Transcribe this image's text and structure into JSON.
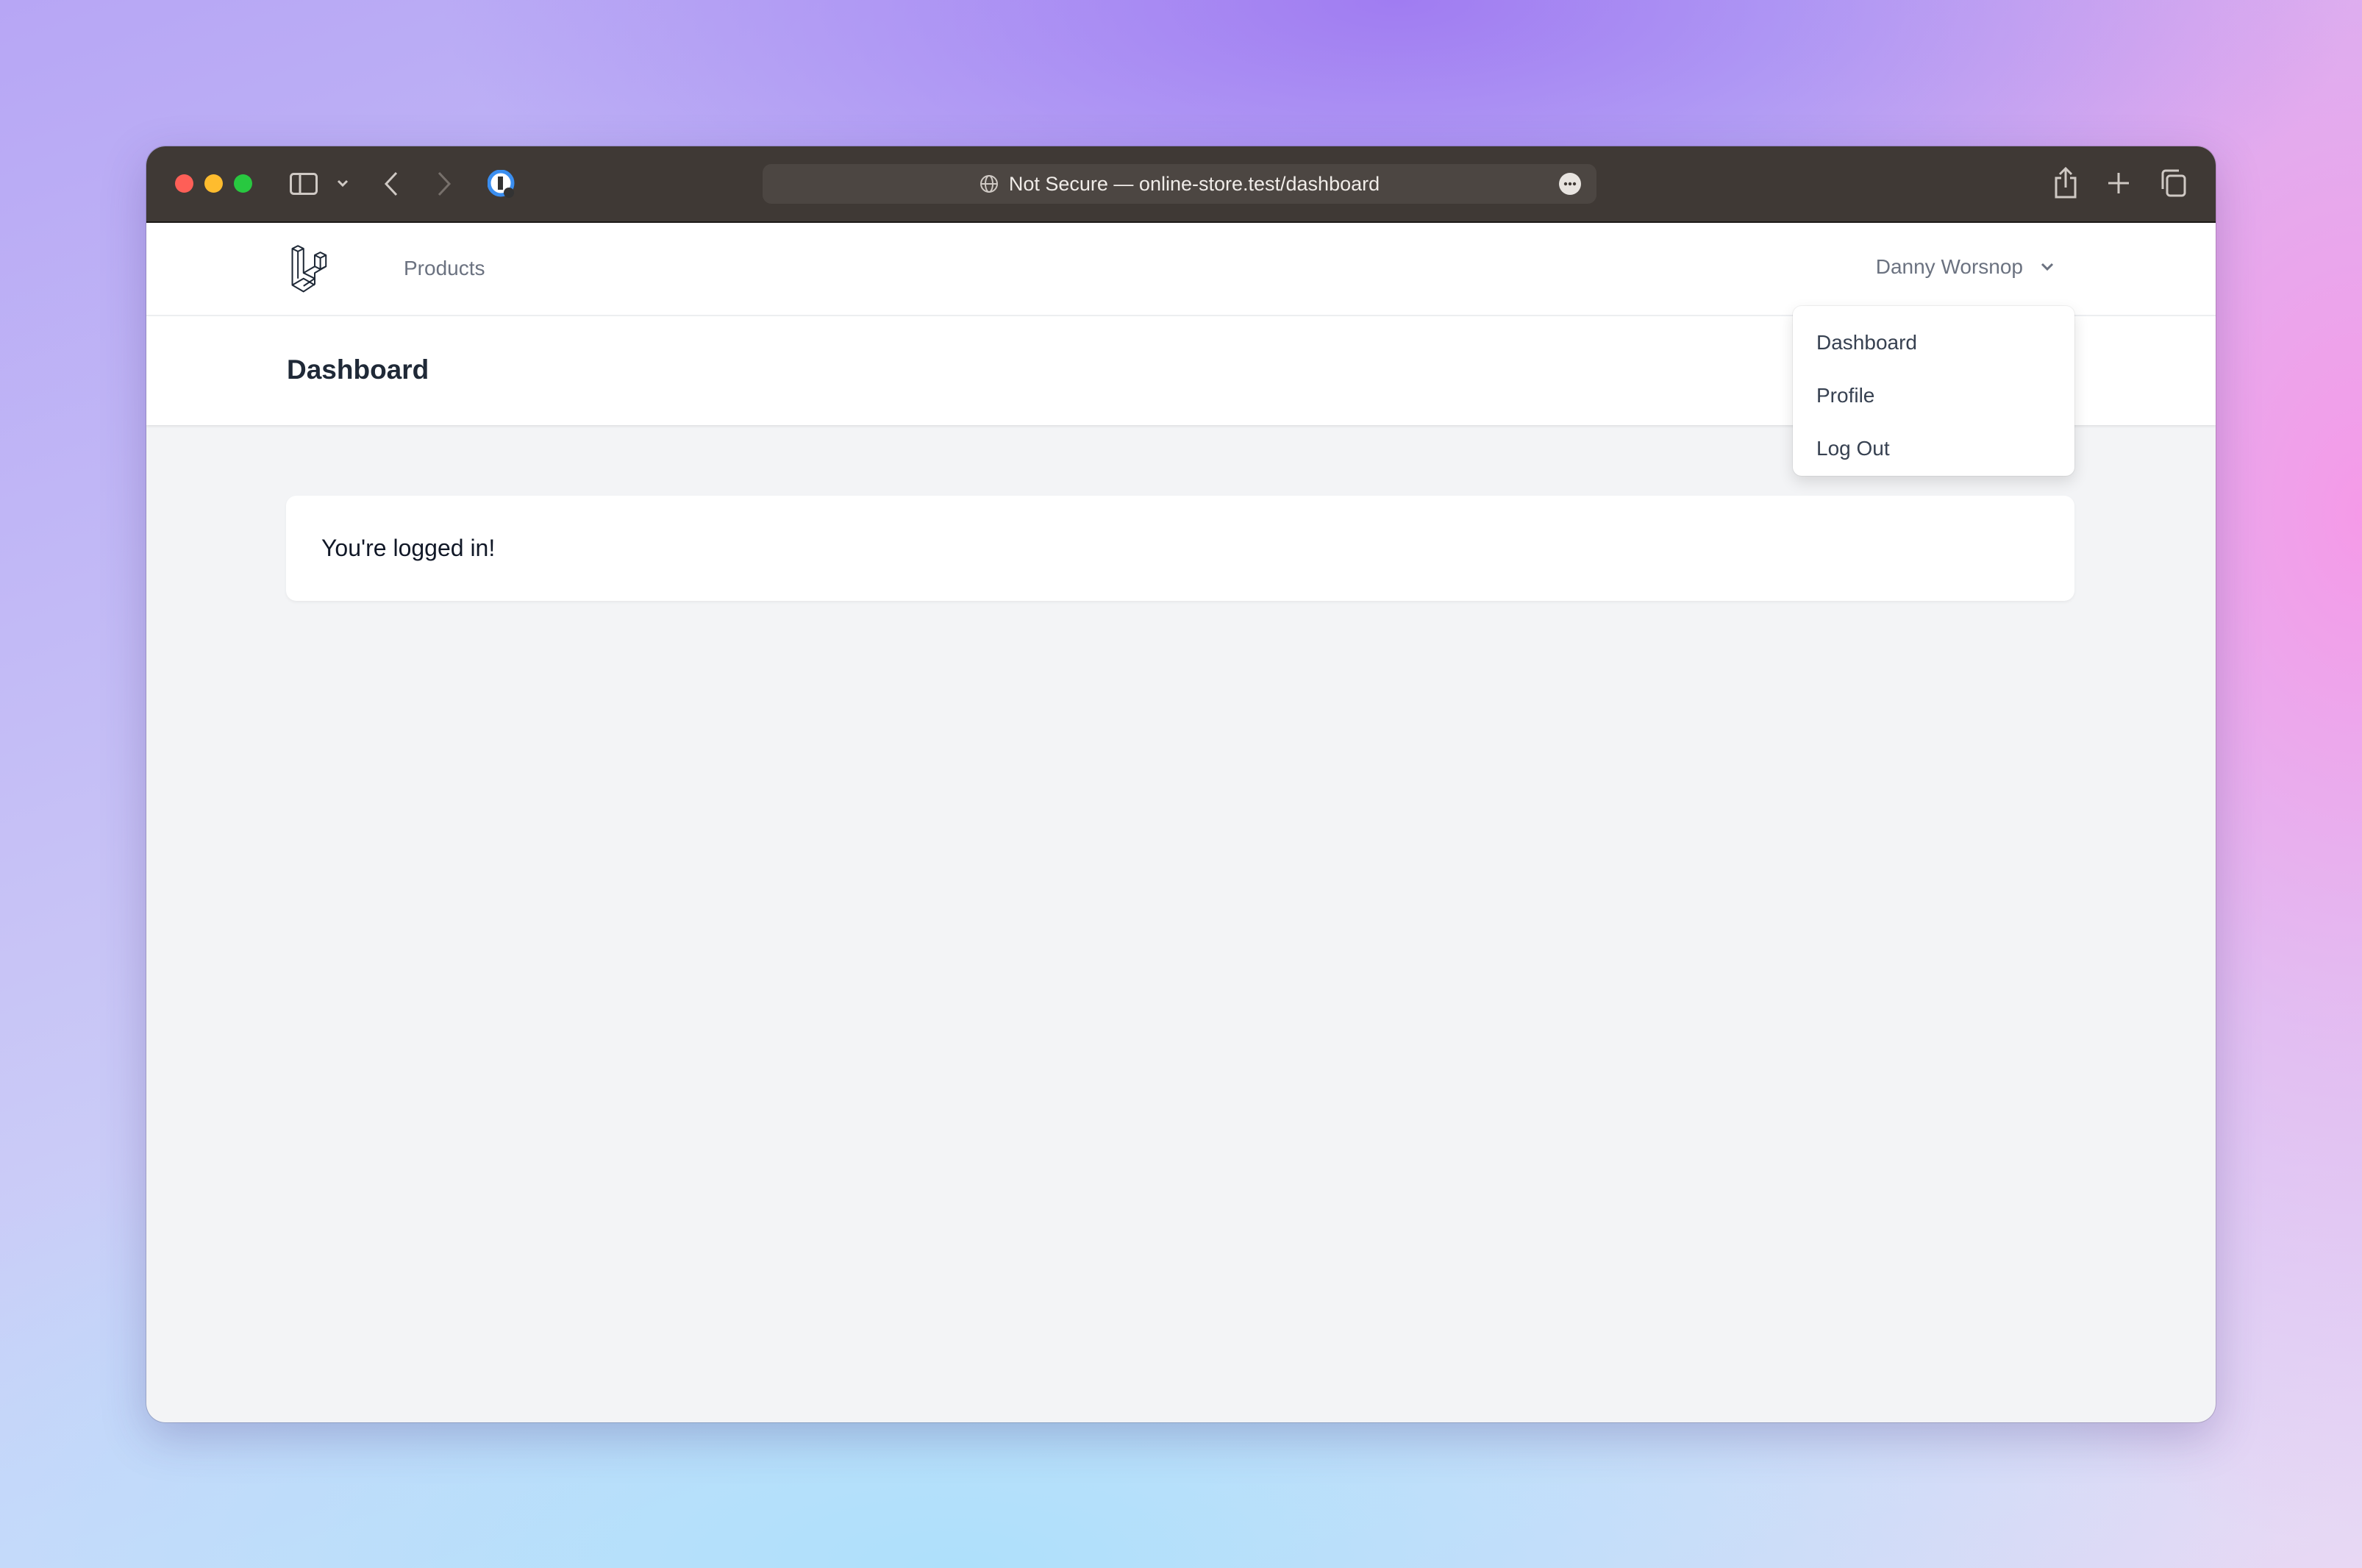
{
  "browser": {
    "address": "Not Secure — online-store.test/dashboard",
    "traffic_lights": {
      "close": "#fe5f57",
      "minimize": "#febc2e",
      "zoom": "#28c840"
    },
    "icons": [
      "sidebar-icon",
      "chevron-down-icon",
      "back-icon",
      "forward-icon",
      "password-manager-icon",
      "globe-icon",
      "more-icon",
      "share-icon",
      "new-tab-icon",
      "tabs-overview-icon"
    ]
  },
  "nav": {
    "logo": "laravel-logo",
    "links": [
      {
        "label": "Products"
      }
    ],
    "user": {
      "name": "Danny Worsnop"
    }
  },
  "dropdown": {
    "items": [
      {
        "label": "Dashboard"
      },
      {
        "label": "Profile"
      },
      {
        "label": "Log Out"
      }
    ]
  },
  "header": {
    "title": "Dashboard"
  },
  "main": {
    "message": "You're logged in!"
  }
}
